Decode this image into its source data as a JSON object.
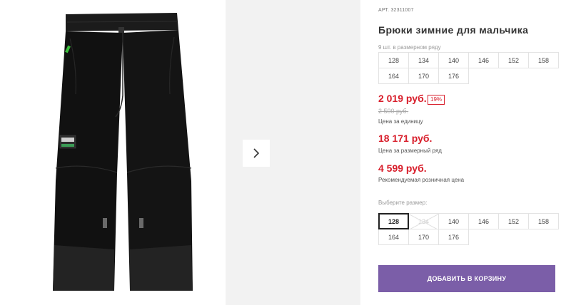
{
  "product": {
    "article_prefix": "АРТ.",
    "article": "32311007",
    "title": "Брюки зимние для мальчика",
    "row_count": "9 шт. в размерном ряду",
    "row_sizes": [
      "128",
      "134",
      "140",
      "146",
      "152",
      "158",
      "164",
      "170",
      "176"
    ]
  },
  "pricing": {
    "unit_price": "2 019 руб.",
    "discount_badge": "19%",
    "old_price": "2 500 руб.",
    "unit_caption": "Цена за единицу",
    "row_price": "18 171 руб.",
    "row_caption": "Цена за размерный ряд",
    "retail_price": "4 599 руб.",
    "retail_caption": "Рекомендуемая розничная цена"
  },
  "size_picker": {
    "label": "Выберите размер:",
    "sizes": [
      "128",
      "134",
      "140",
      "146",
      "152",
      "158",
      "164",
      "170",
      "176"
    ],
    "selected": "128",
    "unavailable": [
      "134"
    ]
  },
  "actions": {
    "add_to_cart": "ДОБАВИТЬ В КОРЗИНУ"
  },
  "colors": {
    "price_red": "#d81e2b",
    "cart_button": "#7b5ea8",
    "thumb_panel": "#f2f2f2"
  },
  "icons": {
    "next": "chevron-right-icon"
  }
}
